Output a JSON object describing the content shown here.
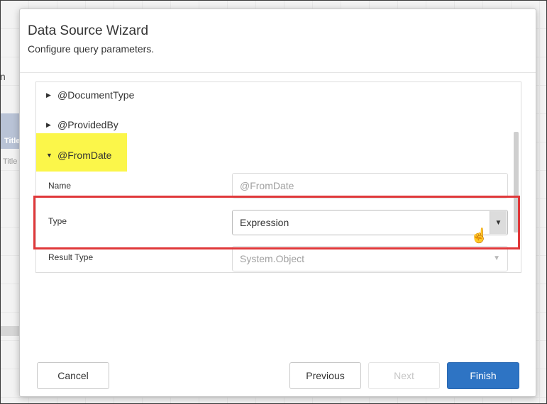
{
  "background": {
    "header_fragment": "n",
    "band_title_1": "Title",
    "band_title_2": "Title"
  },
  "dialog": {
    "title": "Data Source Wizard",
    "subtitle": "Configure query parameters."
  },
  "parameters": [
    {
      "name": "@DocumentType",
      "expanded": false
    },
    {
      "name": "@ProvidedBy",
      "expanded": false
    },
    {
      "name": "@FromDate",
      "expanded": true
    }
  ],
  "properties": {
    "name": {
      "label": "Name",
      "value": "@FromDate"
    },
    "type": {
      "label": "Type",
      "value": "Expression"
    },
    "result_type": {
      "label": "Result Type",
      "value": "System.Object"
    }
  },
  "icons": {
    "collapsed": "triangle-right-icon",
    "expanded": "triangle-down-icon",
    "dropdown": "caret-down-icon",
    "cursor": "hand-pointer-icon"
  },
  "buttons": {
    "cancel": "Cancel",
    "previous": "Previous",
    "next": "Next",
    "finish": "Finish"
  },
  "colors": {
    "primary": "#2e74c4",
    "highlight": "#fbf64a",
    "annotation": "#e0383a"
  }
}
